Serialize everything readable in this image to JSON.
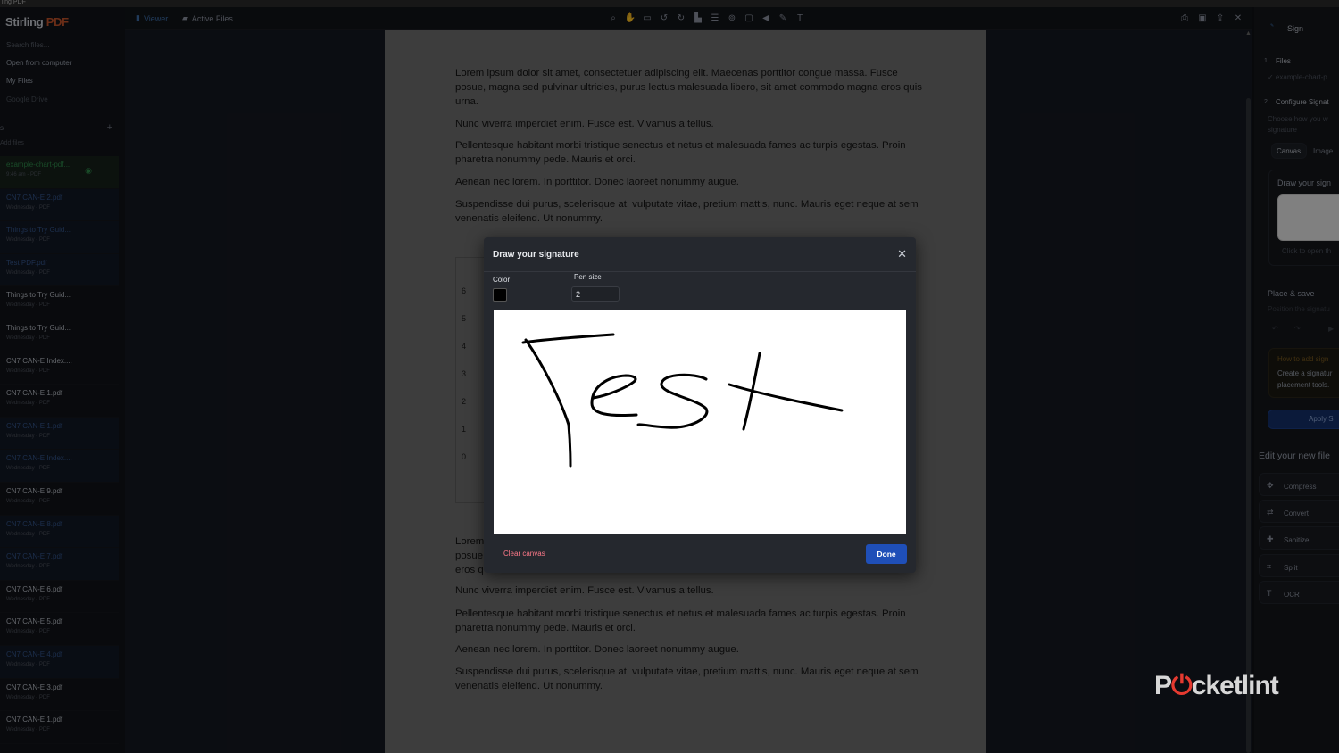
{
  "titlebar": {
    "text": "ling PDF"
  },
  "app": {
    "logo_main": "Stirling",
    "logo_accent": "PDF"
  },
  "topbar": {
    "breadcrumb_viewer": "Viewer",
    "breadcrumb_active": "Active Files",
    "tools": [
      "search-icon",
      "hand-icon",
      "rule-icon",
      "rotate-left-icon",
      "rotate-right-icon",
      "stamp-icon",
      "list-icon",
      "link-icon",
      "comment-icon",
      "audio-icon",
      "pen-icon",
      "text-icon"
    ],
    "right_tools": [
      "print-icon",
      "save-icon",
      "export-icon",
      "close-icon"
    ]
  },
  "sidebar": {
    "search_placeholder": "Search files...",
    "nav": [
      "Open from computer",
      "My Files",
      "Google Drive"
    ],
    "files_header": "s",
    "add_files": "Add files",
    "files": [
      {
        "name": "example-chart-pdf...",
        "meta": "9:46 am - PDF",
        "state": "active"
      },
      {
        "name": "CN7 CAN-E 2.pdf",
        "meta": "Wednesday - PDF",
        "state": "hl"
      },
      {
        "name": "Things to Try Guid...",
        "meta": "Wednesday - PDF",
        "state": "hl"
      },
      {
        "name": "Test PDF.pdf",
        "meta": "Wednesday - PDF",
        "state": "hl"
      },
      {
        "name": "Things to Try Guid...",
        "meta": "Wednesday - PDF",
        "state": ""
      },
      {
        "name": "Things to Try Guid...",
        "meta": "Wednesday - PDF",
        "state": ""
      },
      {
        "name": "CN7 CAN-E Index....",
        "meta": "Wednesday - PDF",
        "state": ""
      },
      {
        "name": "CN7 CAN-E 1.pdf",
        "meta": "Wednesday - PDF",
        "state": ""
      },
      {
        "name": "CN7 CAN-E 1.pdf",
        "meta": "Wednesday - PDF",
        "state": "hl"
      },
      {
        "name": "CN7 CAN-E Index....",
        "meta": "Wednesday - PDF",
        "state": "hl"
      },
      {
        "name": "CN7 CAN-E 9.pdf",
        "meta": "Wednesday - PDF",
        "state": ""
      },
      {
        "name": "CN7 CAN-E 8.pdf",
        "meta": "Wednesday - PDF",
        "state": "hl"
      },
      {
        "name": "CN7 CAN-E 7.pdf",
        "meta": "Wednesday - PDF",
        "state": "hl"
      },
      {
        "name": "CN7 CAN-E 6.pdf",
        "meta": "Wednesday - PDF",
        "state": ""
      },
      {
        "name": "CN7 CAN-E 5.pdf",
        "meta": "Wednesday - PDF",
        "state": ""
      },
      {
        "name": "CN7 CAN-E 4.pdf",
        "meta": "Wednesday - PDF",
        "state": "hl"
      },
      {
        "name": "CN7 CAN-E 3.pdf",
        "meta": "Wednesday - PDF",
        "state": ""
      },
      {
        "name": "CN7 CAN-E 1.pdf",
        "meta": "Wednesday - PDF",
        "state": ""
      }
    ]
  },
  "document": {
    "top_paragraphs": [
      "Lorem ipsum dolor sit amet, consectetuer adipiscing elit. Maecenas porttitor congue massa. Fusce posue, magna sed pulvinar ultricies, purus lectus malesuada libero, sit amet commodo magna eros quis urna.",
      "Nunc viverra imperdiet enim. Fusce est. Vivamus a tellus.",
      "Pellentesque habitant morbi tristique senectus et netus et malesuada fames ac turpis egestas. Proin pharetra nonummy pede. Mauris et orci.",
      "Aenean nec lorem. In porttitor. Donec laoreet nonummy augue.",
      "Suspendisse dui purus, scelerisque at, vulputate vitae, pretium mattis, nunc. Mauris eget neque at sem venenatis eleifend. Ut nonummy."
    ],
    "chart_ticks": [
      "6",
      "5",
      "4",
      "3",
      "2",
      "1",
      "0"
    ],
    "hidden_paragraph_fragments": [
      "Lorem",
      "posue",
      "eros q"
    ],
    "bottom_paragraphs": [
      "Nunc viverra imperdiet enim. Fusce est. Vivamus a tellus.",
      "Pellentesque habitant morbi tristique senectus et netus et malesuada fames ac turpis egestas. Proin pharetra nonummy pede. Mauris et orci.",
      "Aenean nec lorem. In porttitor. Donec laoreet nonummy augue.",
      "Suspendisse dui purus, scelerisque at, vulputate vitae, pretium mattis, nunc. Mauris eget neque at sem venenatis eleifend. Ut nonummy."
    ]
  },
  "right_panel": {
    "title": "Sign",
    "step1_num": "1",
    "step1_label": "Files",
    "step1_file": "✓ example-chart-p",
    "step2_num": "2",
    "step2_label": "Configure Signat",
    "step2_desc_1": "Choose how you w",
    "step2_desc_2": "signature",
    "tab_canvas": "Canvas",
    "tab_image": "Image",
    "draw_label": "Draw your sign",
    "click_open": "Click to open th",
    "place_save": "Place & save",
    "position_sig": "Position the signatu",
    "how_to_add": "How to add sign",
    "create_sig_1": "Create a signatur",
    "create_sig_2": "placement tools.",
    "apply": "Apply S",
    "edit_new": "Edit your new file",
    "tools": [
      "Compress",
      "Convert",
      "Sanitize",
      "Split",
      "OCR"
    ],
    "tool_icons": [
      "compress-icon",
      "convert-icon",
      "sanitize-icon",
      "split-icon",
      "ocr-icon"
    ]
  },
  "modal": {
    "title": "Draw your signature",
    "color_label": "Color",
    "color_value": "#000000",
    "pen_size_label": "Pen size",
    "pen_size_value": "2",
    "clear_label": "Clear canvas",
    "done_label": "Done",
    "signature_word": "Test"
  },
  "watermark": {
    "text_before": "P",
    "text_after": "cketlint"
  },
  "colors": {
    "accent_blue": "#1f4fb8",
    "clear_red": "#ff7a8a",
    "active_green": "#2f8a4a",
    "brand_orange": "#c2532a"
  }
}
